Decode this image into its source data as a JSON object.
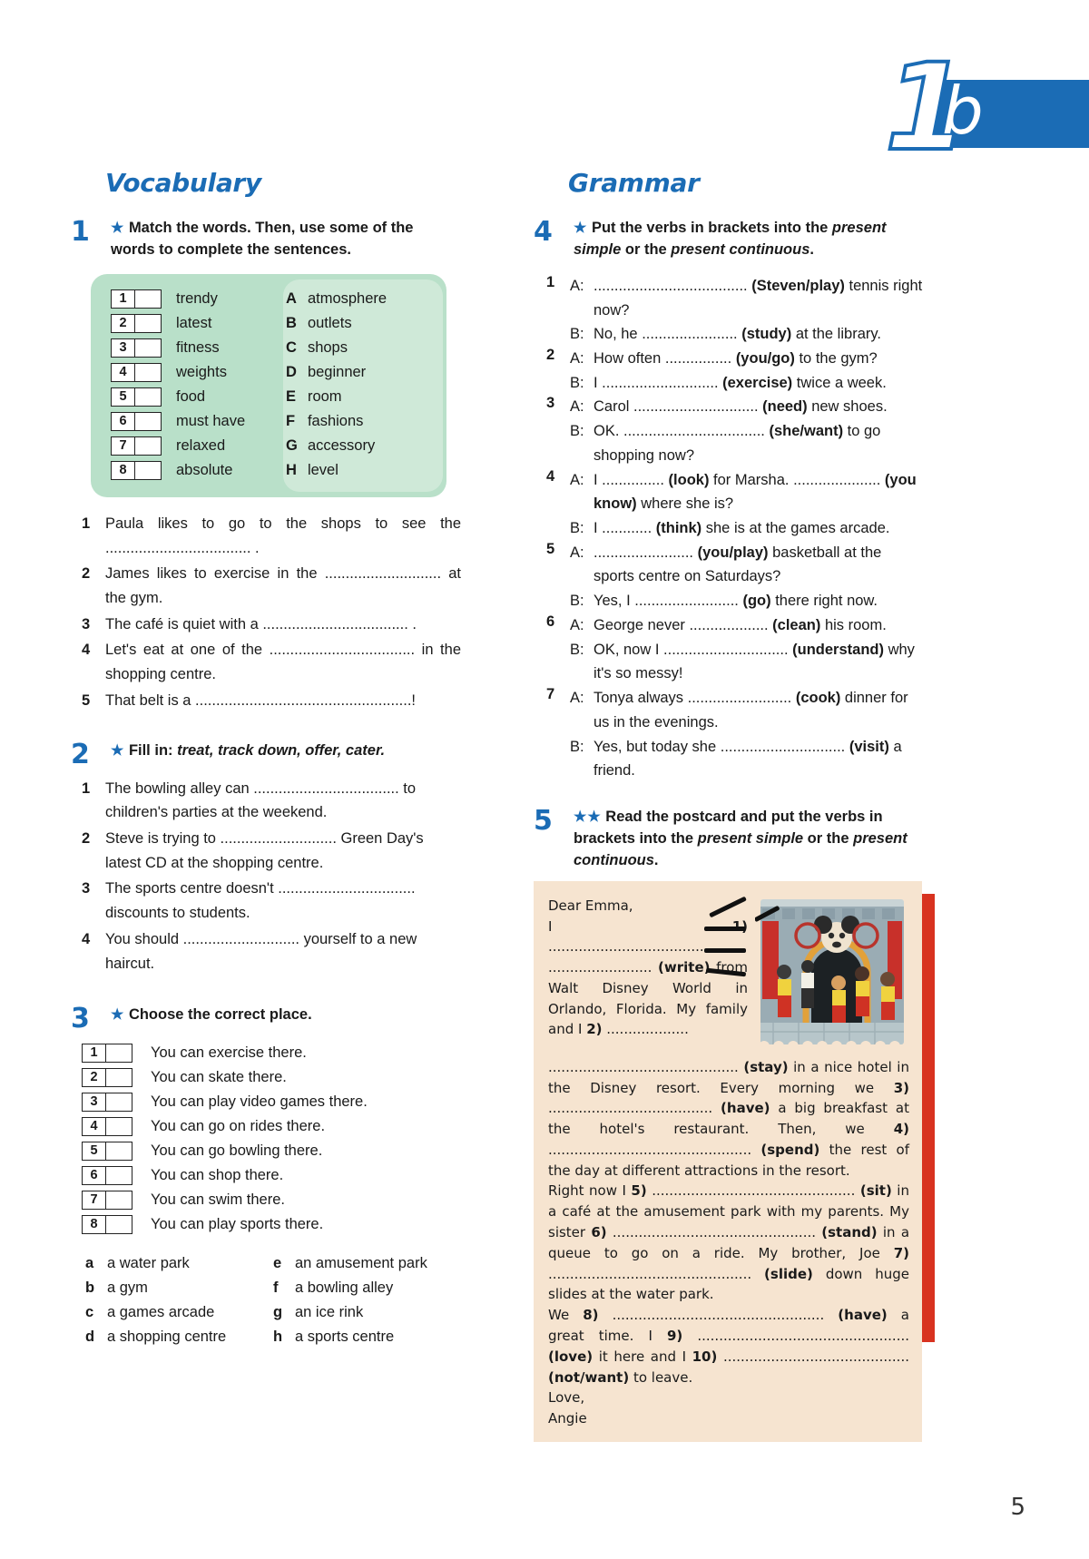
{
  "header": {
    "unit_number": "1",
    "unit_letter": "b",
    "accent_color": "#1b6cb5"
  },
  "page_number": "5",
  "vocabulary": {
    "title": "Vocabulary",
    "ex1": {
      "number": "1",
      "stars": "★",
      "instruction_html": "Match the words. Then, use some of the words to complete the sentences.",
      "left_items": [
        {
          "num": "1",
          "word": "trendy"
        },
        {
          "num": "2",
          "word": "latest"
        },
        {
          "num": "3",
          "word": "fitness"
        },
        {
          "num": "4",
          "word": "weights"
        },
        {
          "num": "5",
          "word": "food"
        },
        {
          "num": "6",
          "word": "must have"
        },
        {
          "num": "7",
          "word": "relaxed"
        },
        {
          "num": "8",
          "word": "absolute"
        }
      ],
      "right_items": [
        {
          "letter": "A",
          "word": "atmosphere"
        },
        {
          "letter": "B",
          "word": "outlets"
        },
        {
          "letter": "C",
          "word": "shops"
        },
        {
          "letter": "D",
          "word": "beginner"
        },
        {
          "letter": "E",
          "word": "room"
        },
        {
          "letter": "F",
          "word": "fashions"
        },
        {
          "letter": "G",
          "word": "accessory"
        },
        {
          "letter": "H",
          "word": "level"
        }
      ],
      "sentences": [
        {
          "num": "1",
          "text": "Paula likes to go to the shops to see the ................................... ."
        },
        {
          "num": "2",
          "text": "James likes to exercise in the ............................ at the gym."
        },
        {
          "num": "3",
          "text": "The café is quiet with a ................................... ."
        },
        {
          "num": "4",
          "text": "Let's eat at one of the ................................... in the shopping centre."
        },
        {
          "num": "5",
          "text": "That belt is a ....................................................!"
        }
      ]
    },
    "ex2": {
      "number": "2",
      "stars": "★",
      "instruction_prefix": "Fill in:",
      "instruction_words": "treat, track down, offer, cater.",
      "sentences": [
        {
          "num": "1",
          "text": "The bowling alley can ................................... to children's parties at the weekend."
        },
        {
          "num": "2",
          "text": "Steve is trying to ............................ Green Day's latest CD at the shopping centre."
        },
        {
          "num": "3",
          "text": "The sports centre doesn't ................................. discounts to students."
        },
        {
          "num": "4",
          "text": "You should ............................ yourself to a new haircut."
        }
      ]
    },
    "ex3": {
      "number": "3",
      "stars": "★",
      "instruction_html": "Choose the correct place.",
      "statements": [
        {
          "num": "1",
          "text": "You can exercise there."
        },
        {
          "num": "2",
          "text": "You can skate there."
        },
        {
          "num": "3",
          "text": "You can play video games there."
        },
        {
          "num": "4",
          "text": "You can go on rides there."
        },
        {
          "num": "5",
          "text": "You can go bowling there."
        },
        {
          "num": "6",
          "text": "You can shop there."
        },
        {
          "num": "7",
          "text": "You can swim there."
        },
        {
          "num": "8",
          "text": "You can play sports there."
        }
      ],
      "options_left": [
        {
          "letter": "a",
          "text": "a water park"
        },
        {
          "letter": "b",
          "text": "a gym"
        },
        {
          "letter": "c",
          "text": "a games arcade"
        },
        {
          "letter": "d",
          "text": "a shopping centre"
        }
      ],
      "options_right": [
        {
          "letter": "e",
          "text": "an amusement park"
        },
        {
          "letter": "f",
          "text": "a bowling alley"
        },
        {
          "letter": "g",
          "text": "an ice rink"
        },
        {
          "letter": "h",
          "text": "a sports centre"
        }
      ]
    }
  },
  "grammar": {
    "title": "Grammar",
    "ex4": {
      "number": "4",
      "stars": "★",
      "instruction_part1": "Put the verbs in brackets into the ",
      "instruction_italic1": "present simple",
      "instruction_part2": " or the ",
      "instruction_italic2": "present continuous",
      "instruction_part3": ".",
      "dialogues": [
        {
          "num": "1",
          "turns": [
            {
              "speaker": "A:",
              "text": "..................................... <b>(Steven/play)</b> tennis right now?"
            },
            {
              "speaker": "B:",
              "text": "No, he ....................... <b>(study)</b> at the library."
            }
          ]
        },
        {
          "num": "2",
          "turns": [
            {
              "speaker": "A:",
              "text": "How often ................ <b>(you/go)</b> to the gym?"
            },
            {
              "speaker": "B:",
              "text": "I ............................ <b>(exercise)</b> twice a week."
            }
          ]
        },
        {
          "num": "3",
          "turns": [
            {
              "speaker": "A:",
              "text": "Carol .............................. <b>(need)</b> new shoes."
            },
            {
              "speaker": "B:",
              "text": "OK. .................................. <b>(she/want)</b> to go shopping now?"
            }
          ]
        },
        {
          "num": "4",
          "turns": [
            {
              "speaker": "A:",
              "text": "I ............... <b>(look)</b> for Marsha. ..................... <b>(you know)</b> where she is?"
            },
            {
              "speaker": "B:",
              "text": "I ............ <b>(think)</b> she is at the games arcade."
            }
          ]
        },
        {
          "num": "5",
          "turns": [
            {
              "speaker": "A:",
              "text": "........................ <b>(you/play)</b> basketball at the sports centre on Saturdays?"
            },
            {
              "speaker": "B:",
              "text": "Yes, I ......................... <b>(go)</b> there right now."
            }
          ]
        },
        {
          "num": "6",
          "turns": [
            {
              "speaker": "A:",
              "text": "George never ................... <b>(clean)</b> his room."
            },
            {
              "speaker": "B:",
              "text": "OK, now I .............................. <b>(understand)</b> why it's so messy!"
            }
          ]
        },
        {
          "num": "7",
          "turns": [
            {
              "speaker": "A:",
              "text": "Tonya always ......................... <b>(cook)</b> dinner for us in the evenings."
            },
            {
              "speaker": "B:",
              "text": "Yes, but today she .............................. <b>(visit)</b> a friend."
            }
          ]
        }
      ]
    },
    "ex5": {
      "number": "5",
      "stars": "★★",
      "instruction_part1": "Read the postcard and put the verbs in brackets into the ",
      "instruction_italic1": "present simple",
      "instruction_part2": " or the ",
      "instruction_italic2": "present continuous",
      "instruction_part3": ".",
      "postcard": {
        "greeting": "Dear Emma,",
        "para_left": "I <b>1)</b> .......................................... ........................ <b>(write)</b> from Walt Disney World in Orlando, Florida. My family and I <b>2)</b> ...................",
        "para_body": "............................................ <b>(stay)</b> in a nice hotel in the Disney resort. Every morning we <b>3)</b> ...................................... <b>(have)</b> a big breakfast at the hotel's restaurant. Then, we <b>4)</b> ............................................... <b>(spend)</b> the rest of the day at different attractions in the resort.",
        "para_body2": "Right now I <b>5)</b> ............................................... <b>(sit)</b> in a café at the amusement park with my parents. My sister <b>6)</b> ............................................... <b>(stand)</b> in a queue to go on a ride. My brother, Joe <b>7)</b> ............................................... <b>(slide)</b> down huge slides at the water park.",
        "para_body3": "We <b>8)</b> ................................................. <b>(have)</b> a great time. I <b>9)</b> ................................................. <b>(love)</b> it here and I <b>10)</b> ........................................... <b>(not/want)</b> to leave.",
        "signoff_1": "Love,",
        "signoff_2": "Angie",
        "photo_alt": "disney-castle-characters-photo",
        "bg_color": "#f6e4d0",
        "border_color": "#d8321f"
      }
    }
  }
}
